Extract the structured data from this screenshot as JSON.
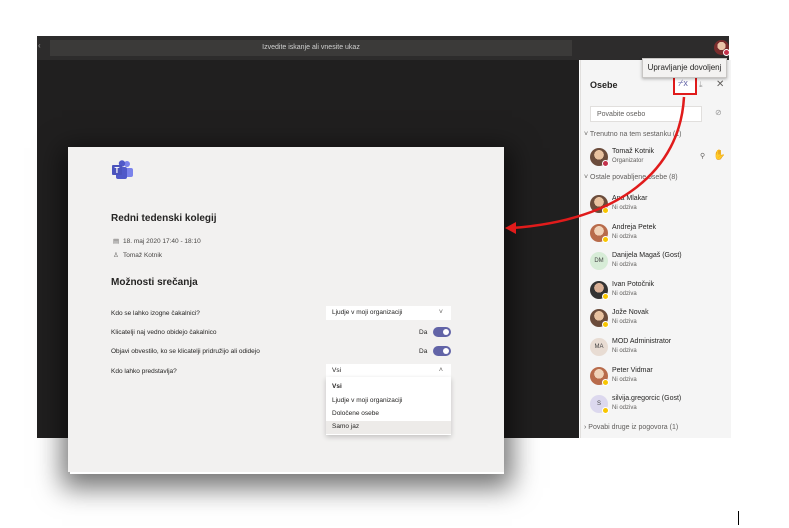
{
  "search": {
    "placeholder": "Izvedite iskanje ali vnesite ukaz"
  },
  "tooltip": {
    "text": "Upravljanje dovoljenj"
  },
  "panel": {
    "title": "Osebe",
    "search_placeholder": "Povabite osebo",
    "section_current": "Trenutno na tem sestanku (1)",
    "section_others": "Ostale povabljene osebe (8)",
    "section_invite": "Povabi druge iz pogovora (1)",
    "organizer": {
      "name": "Tomaž Kotnik",
      "role": "Organizator"
    },
    "invited": [
      {
        "name": "Ana Mlakar",
        "status": "Ni odziva",
        "initials": ""
      },
      {
        "name": "Andreja Petek",
        "status": "Ni odziva",
        "initials": ""
      },
      {
        "name": "Danijela Magaš (Gost)",
        "status": "Ni odziva",
        "initials": "DM"
      },
      {
        "name": "Ivan Potočnik",
        "status": "Ni odziva",
        "initials": ""
      },
      {
        "name": "Jože Novak",
        "status": "Ni odziva",
        "initials": ""
      },
      {
        "name": "MOD Administrator",
        "status": "Ni odziva",
        "initials": "MA"
      },
      {
        "name": "Peter Vidmar",
        "status": "Ni odziva",
        "initials": ""
      },
      {
        "name": "silvija.gregorcic (Gost)",
        "status": "Ni odziva",
        "initials": "S"
      }
    ]
  },
  "meeting": {
    "title": "Redni tedenski kolegij",
    "datetime": "18. maj 2020 17:40 - 18:10",
    "organizer": "Tomaž Kotnik",
    "options_title": "Možnosti srečanja",
    "options": {
      "bypass_label": "Kdo se lahko izogne čakalnici?",
      "bypass_value": "Ljudje v moji organizaciji",
      "callers_label": "Klicatelji naj vedno obidejo čakalnico",
      "callers_value": "Da",
      "announce_label": "Objavi obvestilo, ko se klicatelji pridružijo ali odidejo",
      "announce_value": "Da",
      "present_label": "Kdo lahko predstavlja?",
      "present_value": "Vsi",
      "present_options": [
        "Vsi",
        "Ljudje v moji organizaciji",
        "Določene osebe",
        "Samo jaz"
      ]
    }
  },
  "colors": {
    "accent": "#6264a7",
    "highlight": "#e01b1b",
    "dark": "#201f1f"
  }
}
